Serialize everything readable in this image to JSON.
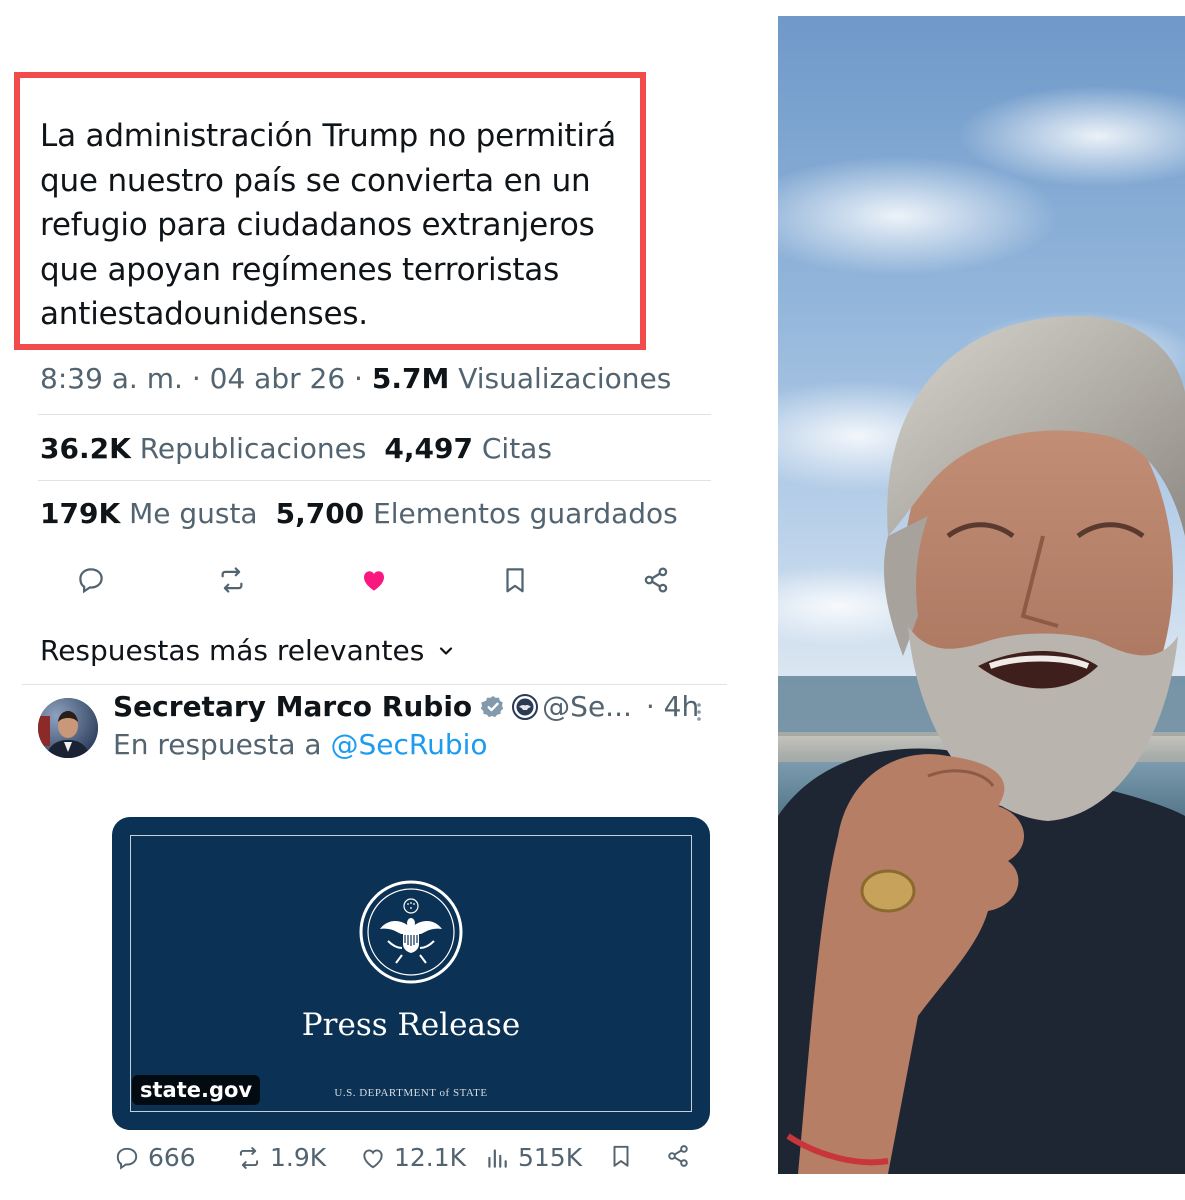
{
  "tweet": {
    "text": "La administración Trump no permitirá\nque nuestro país se convierta en un\nrefugio para ciudadanos extranjeros\nque apoyan regímenes terroristas\nantiestadounidenses.",
    "time": "8:39 a. m.",
    "date": "04 abr 26",
    "separator": " · ",
    "views_count": "5.7M",
    "views_label": "Visualizaciones",
    "reposts_count": "36.2K",
    "reposts_label": "Republicaciones",
    "quotes_count": "4,497",
    "quotes_label": "Citas",
    "likes_count": "179K",
    "likes_label": "Me gusta",
    "bookmarks_count": "5,700",
    "bookmarks_label": "Elementos guardados",
    "liked_color": "#f91880",
    "highlight_color": "#f24b4b"
  },
  "actions": {
    "reply_icon": "reply-icon",
    "repost_icon": "repost-icon",
    "like_icon": "heart-filled-icon",
    "bookmark_icon": "bookmark-icon",
    "share_icon": "share-icon"
  },
  "replies_sort": {
    "label": "Respuestas más relevantes"
  },
  "reply": {
    "author_name": "Secretary Marco Rubio",
    "handle": "@Se...",
    "time": "· 4h",
    "in_reply_prefix": "En respuesta a ",
    "in_reply_handle": "@SecRubio",
    "link_color": "#1d9bf0",
    "verified_color": "#829aab",
    "card": {
      "title": "Press Release",
      "department": "U.S. DEPARTMENT of STATE",
      "source": "state.gov",
      "background": "#0b3154"
    },
    "metrics": {
      "replies": "666",
      "reposts": "1.9K",
      "likes": "12.1K",
      "views": "515K"
    }
  }
}
